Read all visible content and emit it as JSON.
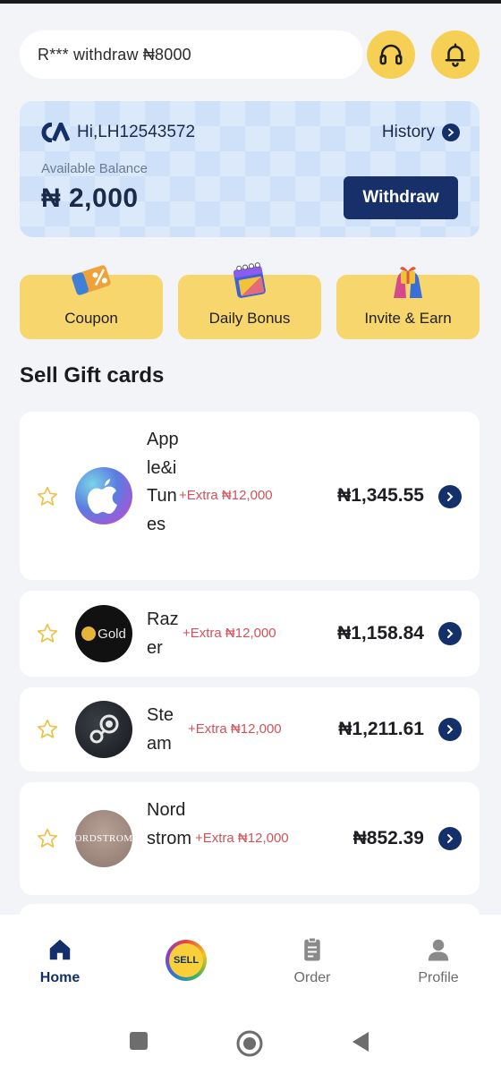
{
  "header": {
    "ticker_text": "R*** withdraw ₦8000",
    "support_icon": "headset-icon",
    "notification_icon": "bell-icon"
  },
  "balance": {
    "greeting": "Hi,LH12543572",
    "history_label": "History",
    "available_label": "Available Balance",
    "amount": "₦ 2,000",
    "withdraw_label": "Withdraw"
  },
  "quick_actions": [
    {
      "label": "Coupon",
      "icon": "coupon-icon"
    },
    {
      "label": "Daily Bonus",
      "icon": "calendar-icon"
    },
    {
      "label": "Invite & Earn",
      "icon": "gift-hands-icon"
    }
  ],
  "section": {
    "title": "Sell Gift cards"
  },
  "gift_cards": [
    {
      "name": "Apple&iTunes",
      "extra": "+Extra ₦12,000",
      "price": "₦1,345.55",
      "logo_text": ""
    },
    {
      "name": "Razer",
      "extra": "+Extra ₦12,000",
      "price": "₦1,158.84",
      "logo_text": "Gold"
    },
    {
      "name": "Steam",
      "extra": "+Extra ₦12,000",
      "price": "₦1,211.61",
      "logo_text": ""
    },
    {
      "name": "Nordstrom",
      "extra": "+Extra ₦12,000",
      "price": "₦852.39",
      "logo_text": "ORDSTROM"
    }
  ],
  "bottom_nav": {
    "home": "Home",
    "sell": "SELL",
    "order": "Order",
    "profile": "Profile"
  },
  "colors": {
    "accent_yellow": "#f6cf55",
    "navy": "#14306b",
    "extra_red": "#d2525a"
  }
}
